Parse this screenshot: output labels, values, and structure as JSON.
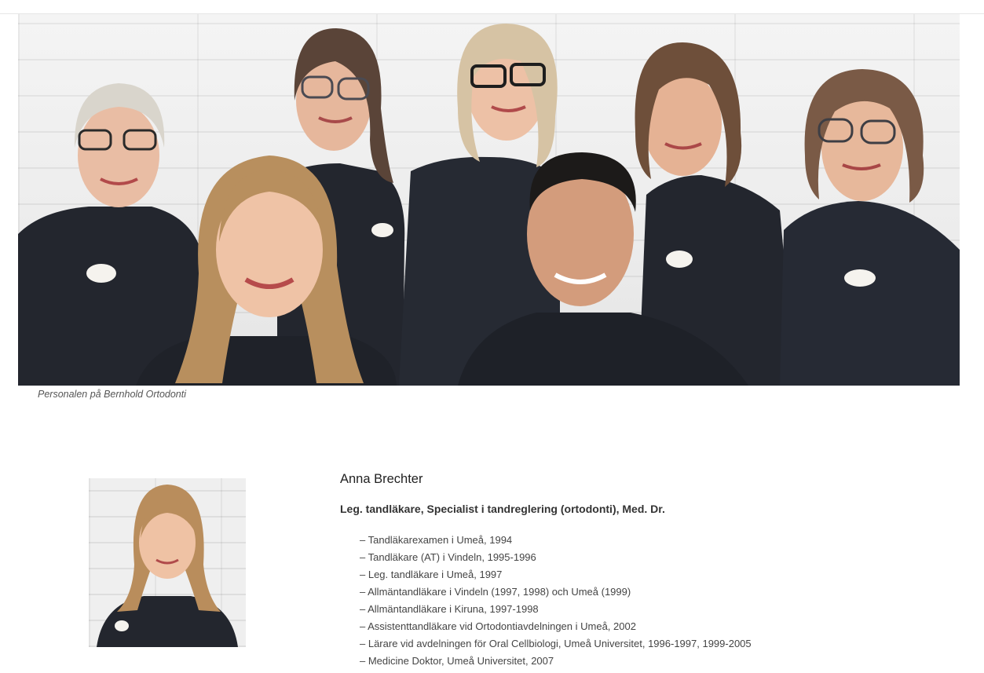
{
  "team_photo": {
    "caption": "Personalen på Bernhold Ortodonti"
  },
  "profile": {
    "name": "Anna Brechter",
    "title": "Leg. tandläkare, Specialist i tandreglering (ortodonti), Med. Dr.",
    "credentials": [
      "– Tandläkarexamen i Umeå, 1994",
      "– Tandläkare (AT) i Vindeln, 1995-1996",
      "– Leg. tandläkare i Umeå, 1997",
      "– Allmäntandläkare i Vindeln (1997, 1998) och Umeå (1999)",
      "– Allmäntandläkare i Kiruna, 1997-1998",
      "– Assistenttandläkare vid Ortodontiavdelningen i Umeå, 2002",
      "– Lärare vid avdelningen för Oral Cellbiologi, Umeå Universitet, 1996-1997, 1999-2005",
      "– Medicine Doktor, Umeå Universitet, 2007"
    ]
  },
  "colors": {
    "scrubs": "#23262e",
    "background": "#ffffff",
    "text": "#333333"
  }
}
